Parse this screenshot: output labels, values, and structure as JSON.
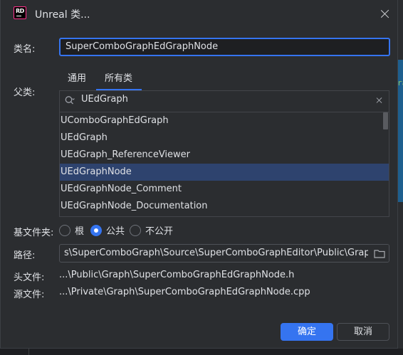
{
  "window": {
    "title": "Unreal 类...",
    "logo_text": "RD"
  },
  "form": {
    "class_name_label": "类名:",
    "class_name_value": "SuperComboGraphEdGraphNode",
    "parent_label": "父类:",
    "tabs": [
      {
        "label": "通用",
        "selected": false
      },
      {
        "label": "所有类",
        "selected": true
      }
    ],
    "search_value": "UEdGraph",
    "classes": [
      "UComboGraphEdGraph",
      "UEdGraph",
      "UEdGraph_ReferenceViewer",
      "UEdGraphNode",
      "UEdGraphNode_Comment",
      "UEdGraphNode_Documentation"
    ],
    "selected_class": "UEdGraphNode",
    "base_folder_label": "基文件夹:",
    "base_folder_options": [
      {
        "label": "根",
        "checked": false
      },
      {
        "label": "公共",
        "checked": true
      },
      {
        "label": "不公开",
        "checked": false
      }
    ],
    "path_label": "路径:",
    "path_value": "s\\SuperComboGraph\\Source\\SuperComboGraphEditor\\Public\\Graph",
    "header_label": "头文件:",
    "header_value": "...\\Public\\Graph\\SuperComboGraphEdGraphNode.h",
    "source_label": "源文件:",
    "source_value": "...\\Private\\Graph\\SuperComboGraphEdGraphNode.cpp"
  },
  "buttons": {
    "ok": "确定",
    "cancel": "取消"
  },
  "colors": {
    "accent": "#3574f0",
    "selection": "#2e436e",
    "background": "#2b2d30",
    "logo_border": "#ff318c"
  },
  "background_fragment": "ra"
}
